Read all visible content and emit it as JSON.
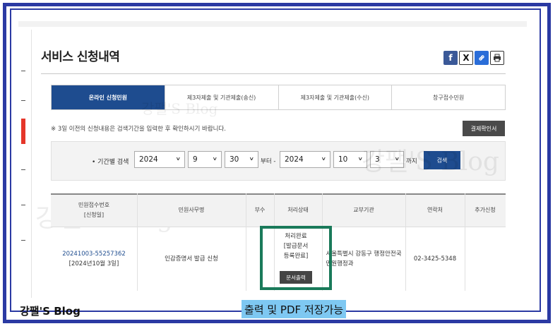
{
  "page_title": "서비스 신청내역",
  "share_icons": [
    {
      "icon": "facebook-icon",
      "glyph": "f"
    },
    {
      "icon": "x-icon",
      "glyph": "X"
    },
    {
      "icon": "link-icon",
      "glyph": "🔗"
    },
    {
      "icon": "print-icon",
      "glyph": "🖶"
    }
  ],
  "tabs": [
    {
      "label": "온라인 신청민원",
      "active": true
    },
    {
      "label": "제3자제출 및 기관제출(송신)",
      "active": false
    },
    {
      "label": "제3자제출 및 기관제출(수신)",
      "active": false
    },
    {
      "label": "창구접수민원",
      "active": false
    }
  ],
  "notice": "※ 3일 이전의 신청내용은 검색기간을 입력한 후 확인하시기 바랍니다.",
  "confirm_button": "결제확인서",
  "search": {
    "label": "• 기간별 검색",
    "from_year": "2024",
    "from_month": "9",
    "from_day": "30",
    "from_suffix": "부터 -",
    "to_year": "2024",
    "to_month": "10",
    "to_day": "3",
    "to_suffix": "까지",
    "button": "검색"
  },
  "table": {
    "headers": [
      "민원접수번호\n[신청일]",
      "민원사무명",
      "부수",
      "처리상태",
      "교부기관",
      "연락처",
      "추가신청"
    ],
    "row": {
      "app_number": "20241003-55257362",
      "app_date": "[2024년10월 3일]",
      "service": "인감증명서 발급 신청",
      "copies": "",
      "status": "처리완료\n[발급문서\n등록완료]",
      "print_button": "문서출력",
      "agency": "서울특별시 강동구 행정안전국\n민원행정과",
      "phone": "02-3425-5348",
      "extra": ""
    }
  },
  "watermarks": [
    "강팰'S Blog",
    "강팰'S Blog",
    "강팰'S Blog"
  ],
  "blog_label": "강팰'S Blog",
  "caption": "출력 및 PDF 저장가능",
  "colors": {
    "frame": "#2b3aa3",
    "tab_active": "#1e4c8f",
    "highlight_box": "#1a7a5a",
    "caption_bg": "#7ec8f2"
  }
}
